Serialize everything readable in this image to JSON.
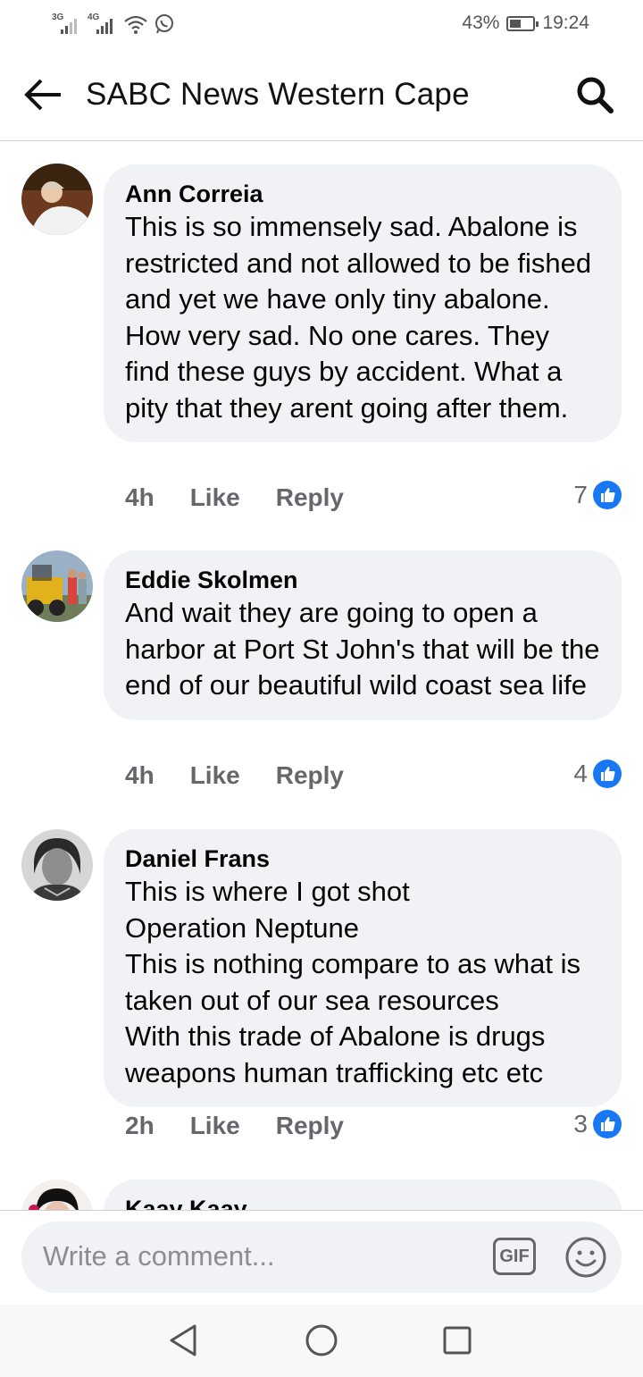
{
  "status_bar": {
    "network_1": "3G",
    "network_2": "4G",
    "battery": "43%",
    "time": "19:24"
  },
  "header": {
    "title": "SABC News Western Cape",
    "back_icon": "arrow-left-icon",
    "search_icon": "search-icon"
  },
  "comments": [
    {
      "author": "Ann Correia",
      "text": "This is so immensely sad.  Abalone is restricted and not allowed to be fished and yet we have only tiny abalone.  How very sad.  No one cares.  They find these guys by accident.  What a pity that they arent going after them.",
      "time": "4h",
      "like_label": "Like",
      "reply_label": "Reply",
      "reaction_count": "7"
    },
    {
      "author": "Eddie Skolmen",
      "text": "And wait they are going to open a harbor at Port St John's that will be the end of our beautiful wild coast sea life",
      "time": "4h",
      "like_label": "Like",
      "reply_label": "Reply",
      "reaction_count": "4"
    },
    {
      "author": "Daniel Frans",
      "text": "This is where I got shot\nOperation Neptune\nThis is nothing compare to as what is taken out of our sea resources\nWith this trade of Abalone is drugs weapons human trafficking etc etc",
      "time": "2h",
      "like_label": "Like",
      "reply_label": "Reply",
      "reaction_count": "3"
    },
    {
      "author": "Kaay Kaay"
    }
  ],
  "composer": {
    "placeholder": "Write a comment...",
    "gif_label": "GIF"
  },
  "colors": {
    "bubble": "#f0f2f5",
    "muted_text": "#65676b",
    "like_blue": "#1877f2"
  }
}
